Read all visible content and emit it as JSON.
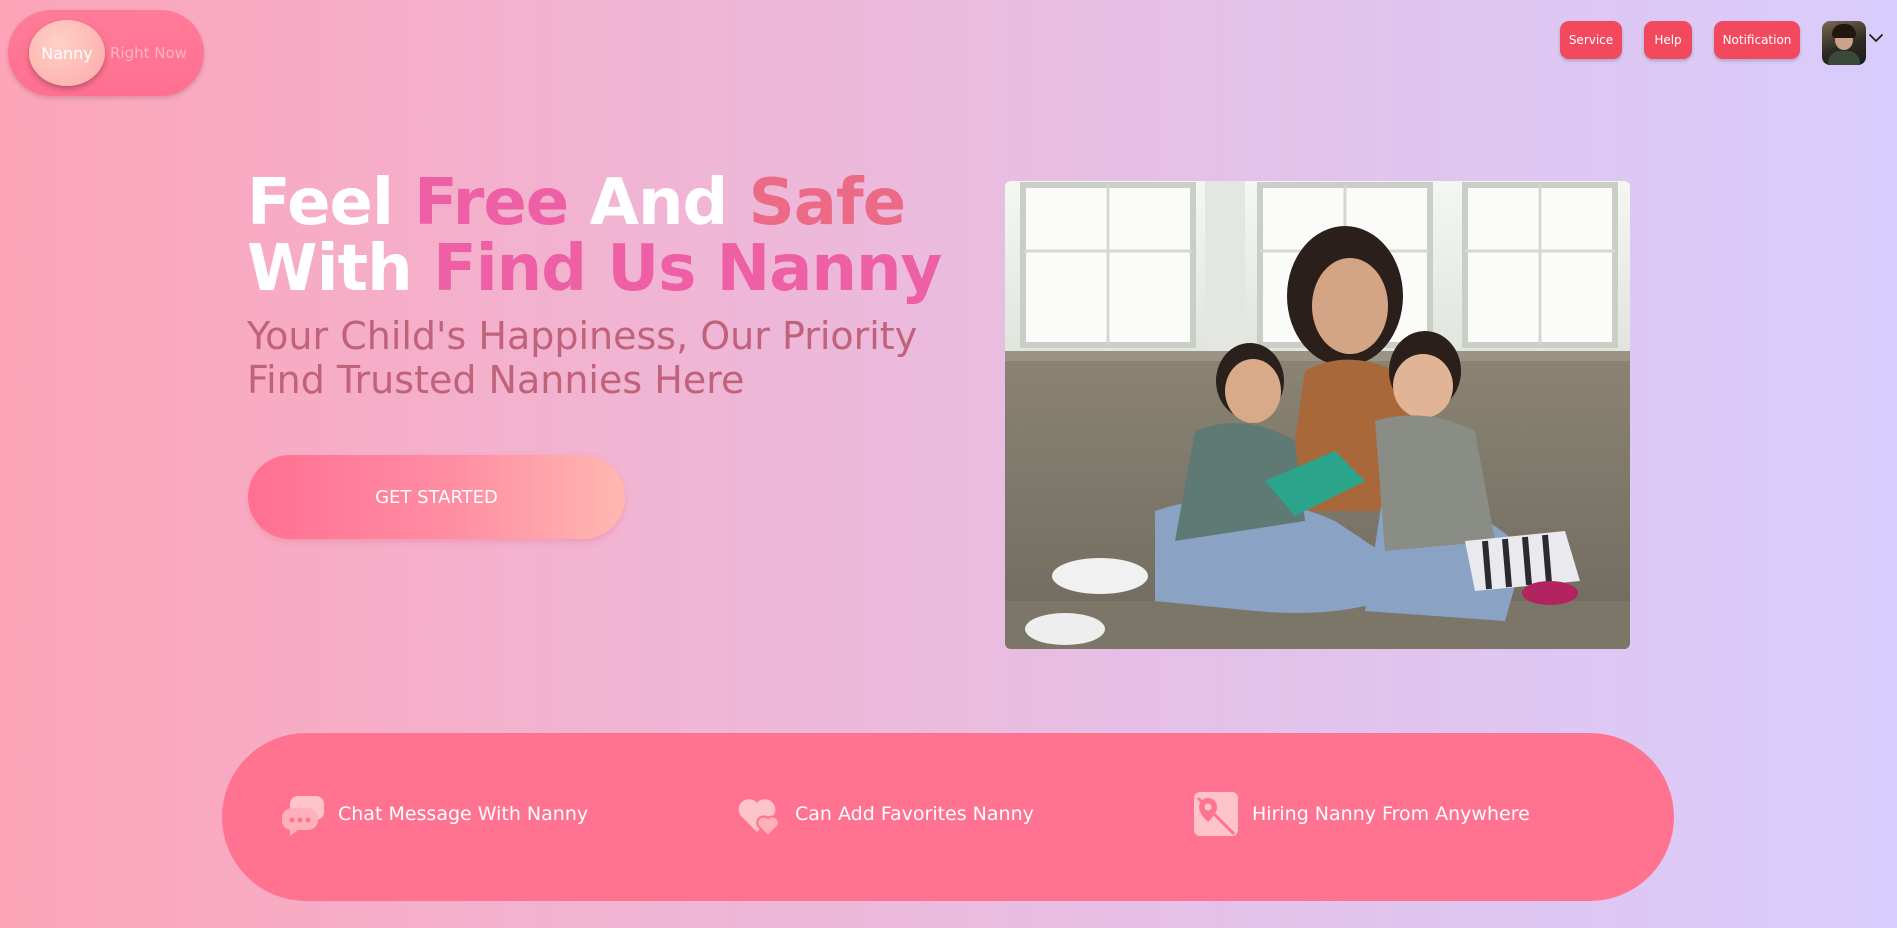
{
  "logo": {
    "word1": "Nanny",
    "word2": "Right Now"
  },
  "nav": {
    "service": "Service",
    "help": "Help",
    "notification": "Notification",
    "avatar_icon": "user-avatar",
    "dropdown_icon": "chevron-down-icon"
  },
  "hero": {
    "title_line1": {
      "w1": "Feel",
      "w2": "Free",
      "w3": "And",
      "w4": "Safe"
    },
    "title_line2": {
      "w1": "With",
      "w2": "Find Us Nanny"
    },
    "subtitle_line1": "Your Child's Happiness, Our Priority",
    "subtitle_line2": "Find Trusted Nannies Here",
    "cta": "GET STARTED"
  },
  "features": [
    {
      "label": "Chat Message With Nanny",
      "icon": "chat-bubbles-icon"
    },
    {
      "label": "Can Add Favorites Nanny",
      "icon": "hearts-icon"
    },
    {
      "label": "Hiring Nanny From Anywhere",
      "icon": "map-pin-icon"
    }
  ],
  "colors": {
    "primary": "#ff7391",
    "nav_button": "#f2495f",
    "title_pink": "#ee5fa6",
    "title_coral": "#ec6a86",
    "subtitle": "#c0627a"
  }
}
